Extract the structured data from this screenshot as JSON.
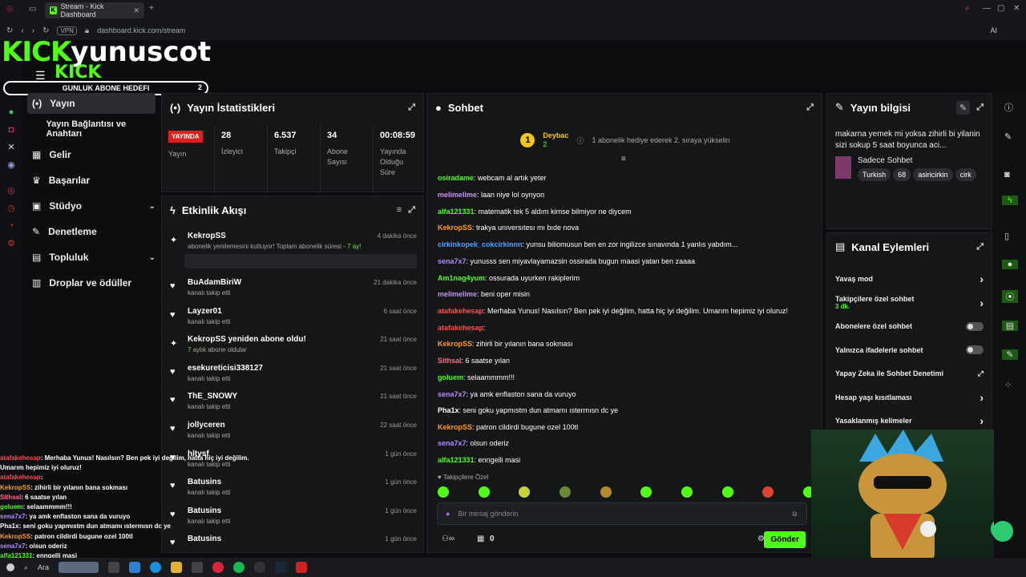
{
  "browser": {
    "tab_title": "Stream - Kick Dashboard",
    "vpn": "VPN",
    "url": "dashboard.kick.com/stream",
    "ai_label": "AI"
  },
  "overlay": {
    "logo_kick": "KICK",
    "logo_name": "yunuscot",
    "logo_small": "KICK",
    "goal_label": "GUNLUK ABONE HEDEFI",
    "goal_value": "2"
  },
  "nav": {
    "items": [
      {
        "label": "Yayın"
      },
      {
        "label": "Yayın Bağlantısı ve Anahtarı"
      },
      {
        "label": "Gelir"
      },
      {
        "label": "Başarılar"
      },
      {
        "label": "Stüdyo"
      },
      {
        "label": "Denetleme"
      },
      {
        "label": "Topluluk"
      },
      {
        "label": "Droplar ve ödüller"
      }
    ]
  },
  "stats": {
    "title": "Yayın İstatistikleri",
    "live_badge": "YAYINDA",
    "live_label": "Yayın",
    "items": [
      {
        "value": "28",
        "label": "İzleyici"
      },
      {
        "value": "6.537",
        "label": "Takipçi"
      },
      {
        "value": "34",
        "label": "Abone Sayısı"
      },
      {
        "value": "00:08:59",
        "label": "Yayında Olduğu Süre"
      }
    ]
  },
  "events": {
    "title": "Etkinlik Akışı",
    "first": {
      "name": "KekropSS",
      "time": "4 dakika önce",
      "desc": "abonelik yenilemesini kutluyor! Toplam abonelik süresi - ",
      "months": "7 ay!"
    },
    "items": [
      {
        "name": "BuAdamBiriW",
        "sub": "kanalı takip etti",
        "time": "21 dakika önce"
      },
      {
        "name": "Layzer01",
        "sub": "kanalı takip etti",
        "time": "6 saat önce"
      },
      {
        "name": "KekropSS yeniden abone oldu!",
        "sub": "aylık abone oldular",
        "months": "7",
        "time": "21 saat önce"
      },
      {
        "name": "esekureticisi338127",
        "sub": "kanalı takip etti",
        "time": "21 saat önce"
      },
      {
        "name": "ThE_SNOWY",
        "sub": "kanalı takip etti",
        "time": "21 saat önce"
      },
      {
        "name": "jollyceren",
        "sub": "kanalı takip etti",
        "time": "22 saat önce"
      },
      {
        "name": "hltysf",
        "sub": "kanalı takip etti",
        "time": "1 gün önce"
      },
      {
        "name": "Batusins",
        "sub": "kanalı takip etti",
        "time": "1 gün önce"
      },
      {
        "name": "Batusins",
        "sub": "kanalı takip etti",
        "time": "1 gün önce"
      },
      {
        "name": "Batusins",
        "sub": "",
        "time": "1 gün önce"
      }
    ]
  },
  "overlay_chat": [
    {
      "user": "atafakehesap",
      "color": "#ff4d4d",
      "text": ": Merhaba Yunus! Nasılsın? Ben pek iyi değilim, hatta hiç iyi değilim."
    },
    {
      "user": "",
      "color": "#fff",
      "text": "Umarım hepimiz iyi oluruz!"
    },
    {
      "user": "atafakehesap",
      "color": "#ff4d4d",
      "text": ":"
    },
    {
      "user": "KekropSS",
      "color": "#ff9a1f",
      "text": ": zihirli bir yılanın bana sokması"
    },
    {
      "user": "Sithsal",
      "color": "#ff6b8a",
      "text": ": 6 saatse yılan"
    },
    {
      "user": "goluem",
      "color": "#53fc18",
      "text": ": selaammmm!!!"
    },
    {
      "user": "sena7x7",
      "color": "#b388ff",
      "text": ": ya amk enflaston sana da vuruyo"
    },
    {
      "user": "Pha1x",
      "color": "#fff",
      "text": ": seni goku yapmıstm dun atmamı ıstermısn dc ye"
    },
    {
      "user": "KekropSS",
      "color": "#ff9a1f",
      "text": ": patron cildirdi bugune ozel 100tl"
    },
    {
      "user": "sena7x7",
      "color": "#b388ff",
      "text": ": olsun oderiz"
    },
    {
      "user": "alfa121331",
      "color": "#53fc18",
      "text": ": enngelli masi"
    }
  ],
  "chat": {
    "title": "Sohbet",
    "gift": {
      "rank": "1",
      "user": "Deybac",
      "count": "2",
      "text": "1 abonelik hediye ederek 2. sıraya yükselin"
    },
    "messages": [
      {
        "user": "osiradame",
        "color": "#53fc18",
        "text": ": webcam al artık yeter"
      },
      {
        "user": "melimelime",
        "color": "#c792ea",
        "text": ": laan niye lol oynyon"
      },
      {
        "user": "alfa121331",
        "color": "#53fc18",
        "text": ": matematik tek 5 aldım kimse bilmiyor ne diycem"
      },
      {
        "user": "KekropSS",
        "color": "#ff9a1f",
        "text": ": trakya unıversıtesı mı bıde nova"
      },
      {
        "user": "cirkinkopek_cokcirkinnn",
        "color": "#4da3ff",
        "text": ": yunsu biliomusun ben en zor ingilizce sınavında 1 yanlıs yabdım..."
      },
      {
        "user": "sena7x7",
        "color": "#b388ff",
        "text": ": yunusss sen miyavlayamazsin ossirada bugun maasi yatan ben zaaaa"
      },
      {
        "user": "Am1nag4yum",
        "color": "#53fc18",
        "text": ": ossurada uyurken rakiplerim"
      },
      {
        "user": "melimelime",
        "color": "#c792ea",
        "text": ": beni oper misin"
      },
      {
        "user": "atafakehesap",
        "color": "#ff4d4d",
        "text": ": Merhaba Yunus! Nasılsın? Ben pek iyi değilim, hatta hiç iyi değilim. Umarım hepimiz iyi oluruz!"
      },
      {
        "user": "atafakehesap",
        "color": "#ff4d4d",
        "text": ":"
      },
      {
        "user": "KekropSS",
        "color": "#ff9a1f",
        "text": ": zihirli bir yılanın bana sokması"
      },
      {
        "user": "Sithsal",
        "color": "#ff6b8a",
        "text": ": 6 saatse yılan"
      },
      {
        "user": "goluem",
        "color": "#53fc18",
        "text": ": selaammmm!!!"
      },
      {
        "user": "sena7x7",
        "color": "#b388ff",
        "text": ": ya amk enflaston sana da vuruyo"
      },
      {
        "user": "Pha1x",
        "color": "#fff",
        "text": ": seni goku yapmıstm dun atmamı ıstermısn dc ye"
      },
      {
        "user": "KekropSS",
        "color": "#ff9a1f",
        "text": ": patron cildirdi bugune ozel 100tl"
      },
      {
        "user": "sena7x7",
        "color": "#b388ff",
        "text": ": olsun oderiz"
      },
      {
        "user": "alfa121331",
        "color": "#53fc18",
        "text": ": enngelli masi"
      }
    ],
    "followers_only": "Takipçilere Özel",
    "placeholder": "Bir mesaj gönderin",
    "count_zero": "0",
    "send": "Gönder"
  },
  "info": {
    "title": "Yayın bilgisi",
    "stream_title": "makarna yemek mi yoksa zihirli bi yilanin sizi sokup 5 saat boyunca aci...",
    "category": "Sadece Sohbet",
    "tags": [
      "Turkish",
      "68",
      "asiricirkin",
      "cirk"
    ]
  },
  "actions": {
    "title": "Kanal Eylemleri",
    "items": [
      {
        "label": "Yavaş mod",
        "sub": "",
        "type": "chev"
      },
      {
        "label": "Takipçilere özel sohbet",
        "sub": "3 dk.",
        "type": "chev"
      },
      {
        "label": "Abonelere özel sohbet",
        "sub": "",
        "type": "toggle"
      },
      {
        "label": "Yalnızca ifadelerle sohbet",
        "sub": "",
        "type": "toggle"
      },
      {
        "label": "Yapay Zeka ile Sohbet Denetimi",
        "sub": "",
        "type": "ext"
      },
      {
        "label": "Hesap yaşı kısıtlaması",
        "sub": "",
        "type": "chev"
      },
      {
        "label": "Yasaklanmış kelimeler",
        "sub": "",
        "type": "chev"
      }
    ]
  },
  "taskbar": {
    "search": "Ara"
  },
  "colors": {
    "accent": "#53fc18",
    "live": "#e11d1d",
    "panel": "#151618"
  }
}
